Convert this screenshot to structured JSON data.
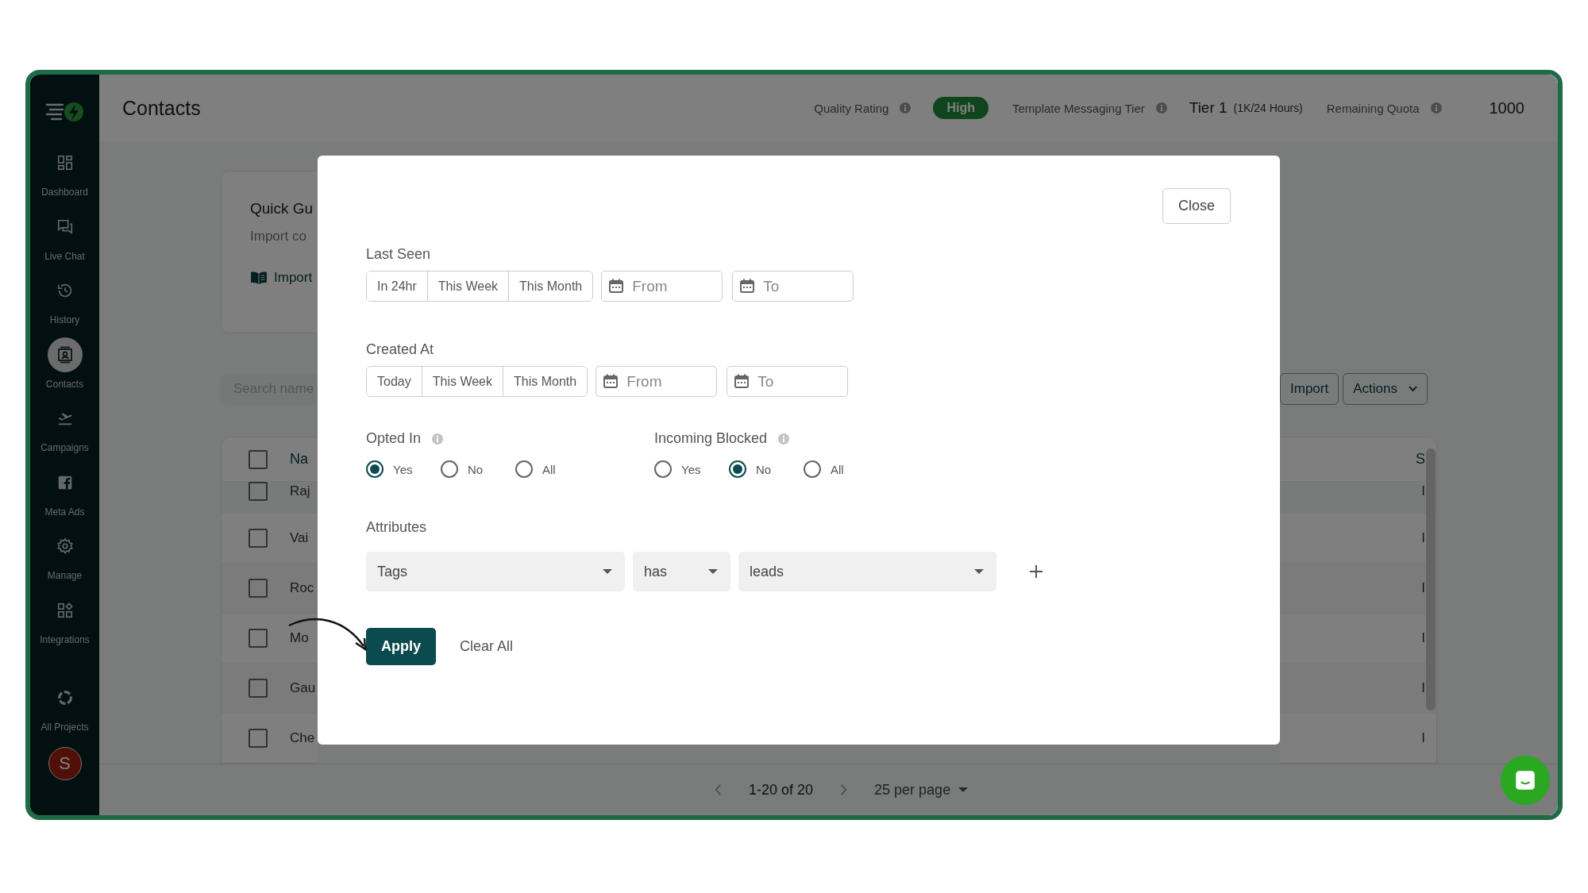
{
  "sidebar": {
    "items": [
      {
        "label": "Dashboard",
        "selected": false
      },
      {
        "label": "Live Chat",
        "selected": false
      },
      {
        "label": "History",
        "selected": false
      },
      {
        "label": "Contacts",
        "selected": true
      },
      {
        "label": "Campaigns",
        "selected": false
      },
      {
        "label": "Meta Ads",
        "selected": false
      },
      {
        "label": "Manage",
        "selected": false
      },
      {
        "label": "Integrations",
        "selected": false
      }
    ],
    "footer_item": {
      "label": "All Projects"
    },
    "avatar": {
      "initial": "S"
    }
  },
  "header": {
    "title": "Contacts",
    "quality_label": "Quality Rating",
    "quality_badge": "High",
    "tier_label": "Template Messaging Tier",
    "tier_value": "Tier 1",
    "tier_note": "(1K/24 Hours)",
    "quota_label": "Remaining Quota",
    "quota_value": "1000"
  },
  "background": {
    "guide_title": "Quick Gu",
    "guide_text": "Import co",
    "guide_link": "Import",
    "search": {
      "placeholder": "Search name"
    },
    "import_button": "Import",
    "actions_button": "Actions",
    "table": {
      "column_1": "Na",
      "column_2": "S",
      "header_checked": false,
      "rows": [
        {
          "name": "Raj",
          "column_2": "I",
          "checked": false
        },
        {
          "name": "Vai",
          "column_2": "I",
          "checked": false
        },
        {
          "name": "Roc",
          "column_2": "I",
          "checked": false
        },
        {
          "name": "Mo",
          "column_2": "I",
          "checked": false
        },
        {
          "name": "Gau",
          "column_2": "I",
          "checked": false
        },
        {
          "name": "Che",
          "column_2": "I",
          "checked": false
        }
      ]
    }
  },
  "pagination": {
    "range": "1-20 of 20",
    "per_page": "25 per page"
  },
  "modal": {
    "close": "Close",
    "last_seen": {
      "label": "Last Seen",
      "presets": [
        {
          "label": "In 24hr",
          "selected": false
        },
        {
          "label": "This Week",
          "selected": false
        },
        {
          "label": "This Month",
          "selected": false
        }
      ],
      "from": {
        "placeholder": "From"
      },
      "to": {
        "placeholder": "To"
      }
    },
    "created_at": {
      "label": "Created At",
      "presets": [
        {
          "label": "Today",
          "selected": false
        },
        {
          "label": "This Week",
          "selected": false
        },
        {
          "label": "This Month",
          "selected": false
        }
      ],
      "from": {
        "placeholder": "From"
      },
      "to": {
        "placeholder": "To"
      }
    },
    "opted_in": {
      "label": "Opted In",
      "options": [
        {
          "label": "Yes",
          "selected": true
        },
        {
          "label": "No",
          "selected": false
        },
        {
          "label": "All",
          "selected": false
        }
      ]
    },
    "incoming_blocked": {
      "label": "Incoming Blocked",
      "options": [
        {
          "label": "Yes",
          "selected": false
        },
        {
          "label": "No",
          "selected": true
        },
        {
          "label": "All",
          "selected": false
        }
      ]
    },
    "attributes": {
      "label": "Attributes",
      "filters": [
        {
          "value": "Tags"
        },
        {
          "value": "has"
        },
        {
          "value": "leads"
        }
      ]
    },
    "apply": "Apply",
    "clear": "Clear All"
  }
}
